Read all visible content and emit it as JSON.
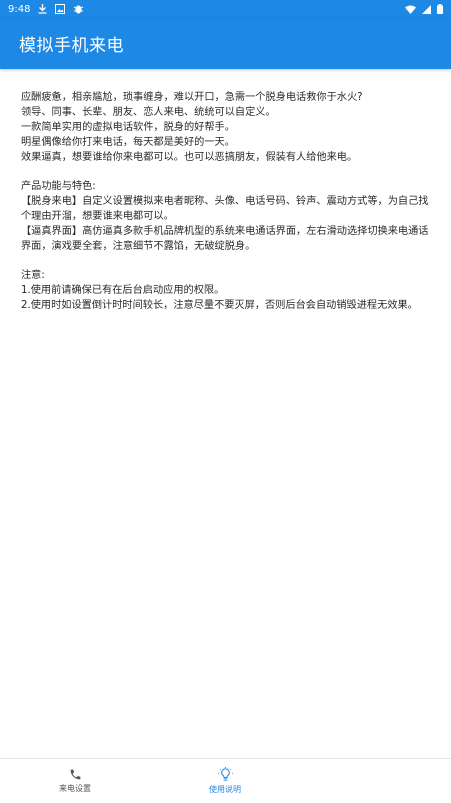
{
  "status_bar": {
    "time": "9:48",
    "bg_color": "#1e88e5"
  },
  "app_bar": {
    "title": "模拟手机来电"
  },
  "content": {
    "intro": [
      "应酬疲惫，相亲尴尬，琐事缠身，难以开口，急需一个脱身电话救你于水火?",
      "领导、同事、长辈、朋友、恋人来电、统统可以自定义。",
      "一款简单实用的虚拟电话软件，脱身的好帮手。",
      "明星偶像给你打来电话，每天都是美好的一天。",
      "效果逼真，想要谁给你来电都可以。也可以恶搞朋友，假装有人给他来电。"
    ],
    "features": [
      "产品功能与特色:",
      "【脱身来电】自定义设置模拟来电者昵称、头像、电话号码、铃声、震动方式等，为自己找个理由开溜，想要谁来电都可以。",
      "【逼真界面】高仿逼真多款手机品牌机型的系统来电通话界面，左右滑动选择切换来电通话界面，演戏要全套，注意细节不露馅，无破绽脱身。"
    ],
    "notes": [
      "注意:",
      "1.使用前请确保已有在后台启动应用的权限。",
      "2.使用时如设置倒计时时间较长，注意尽量不要灭屏，否则后台会自动销毁进程无效果。"
    ]
  },
  "bottom_nav": {
    "items": [
      {
        "label": "来电设置",
        "icon": "phone-icon",
        "active": false
      },
      {
        "label": "使用说明",
        "icon": "lightbulb-icon",
        "active": true
      }
    ],
    "active_color": "#1e88e5",
    "inactive_color": "#555555"
  }
}
